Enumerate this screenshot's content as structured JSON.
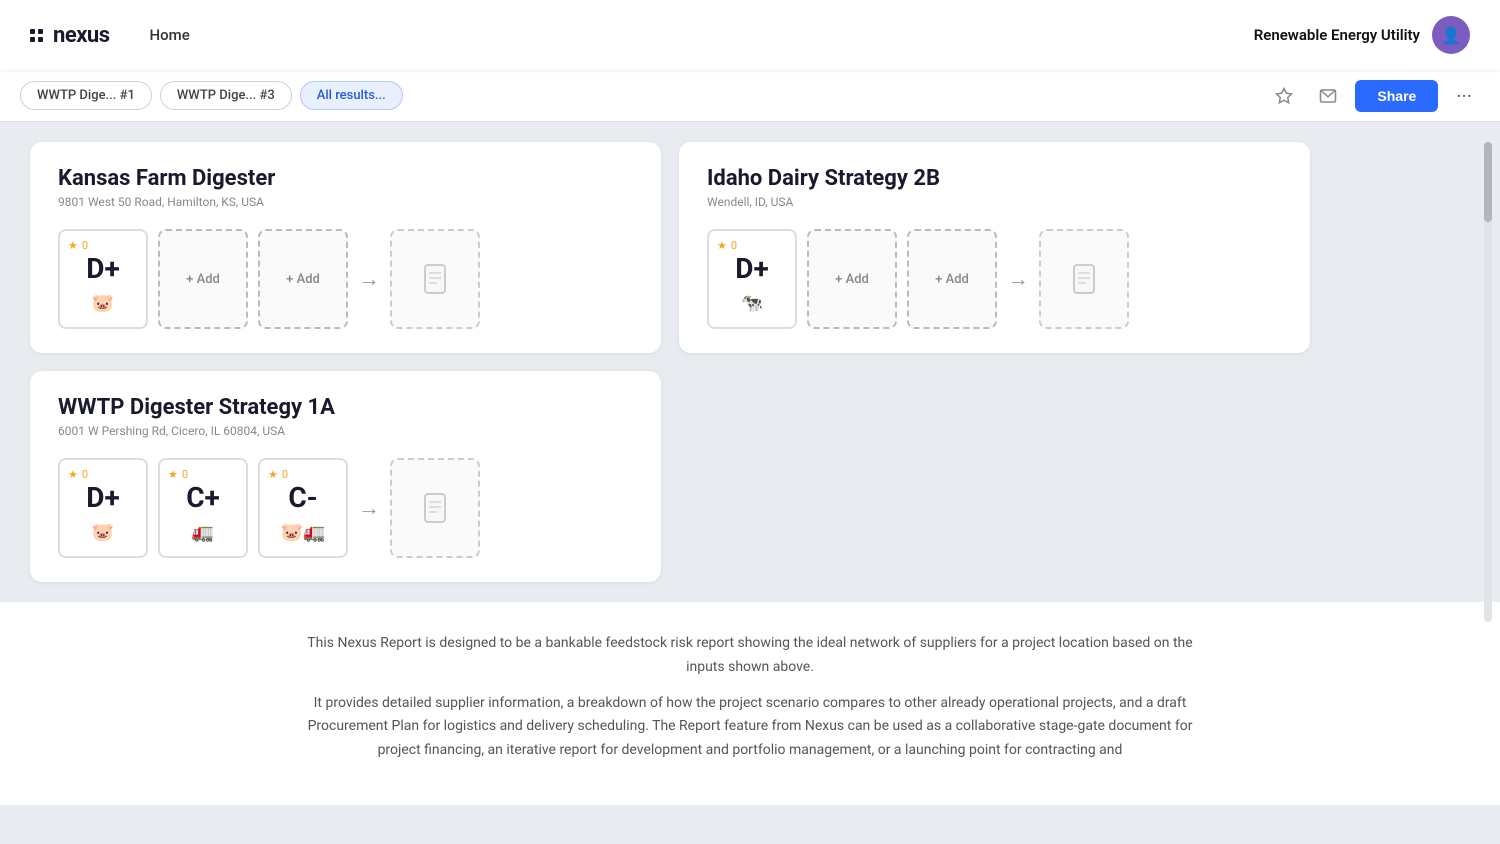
{
  "header": {
    "logo_text": "nexus",
    "nav": [
      {
        "label": "Home",
        "active": true
      }
    ],
    "user_label": "Renewable Energy Utility",
    "user_avatar_icon": "👤"
  },
  "tabs": {
    "items": [
      {
        "label": "WWTP Dige...  #1",
        "active": false
      },
      {
        "label": "WWTP Dige...  #3",
        "active": false
      },
      {
        "label": "All results...",
        "active": true
      }
    ],
    "share_label": "Share"
  },
  "cards": [
    {
      "title": "Kansas Farm Digester",
      "address": "9801 West 50 Road, Hamilton, KS, USA",
      "strategies": [
        {
          "type": "grade",
          "grade": "D+",
          "stars": 0,
          "icon": "pig"
        },
        {
          "type": "add"
        },
        {
          "type": "add"
        },
        {
          "type": "arrow"
        },
        {
          "type": "report"
        }
      ]
    },
    {
      "title": "Idaho Dairy Strategy 2B",
      "address": "Wendell, ID, USA",
      "strategies": [
        {
          "type": "grade",
          "grade": "D+",
          "stars": 0,
          "icon": "cow"
        },
        {
          "type": "add"
        },
        {
          "type": "add"
        },
        {
          "type": "arrow"
        },
        {
          "type": "report"
        }
      ]
    },
    {
      "title": "WWTP Digester Strategy 1A",
      "address": "6001 W Pershing Rd, Cicero, IL 60804, USA",
      "strategies": [
        {
          "type": "grade",
          "grade": "D+",
          "stars": 0,
          "icon": "pig"
        },
        {
          "type": "grade2",
          "grade": "C+",
          "stars": 0,
          "icon": "truck"
        },
        {
          "type": "grade3",
          "grade": "C-",
          "stars": 0,
          "icon": "pig-truck"
        },
        {
          "type": "arrow"
        },
        {
          "type": "report"
        }
      ]
    }
  ],
  "footer": {
    "paragraph1": "This Nexus Report is designed to be a bankable feedstock risk report showing the ideal network of suppliers for a project location based on the inputs shown above.",
    "paragraph2": "It provides detailed supplier information, a breakdown of how the project scenario compares to other already operational projects, and a draft Procurement Plan for logistics and delivery scheduling. The Report feature from Nexus can be used as a collaborative stage-gate document for project financing, an iterative report for development and portfolio management, or a launching point for contracting and"
  }
}
